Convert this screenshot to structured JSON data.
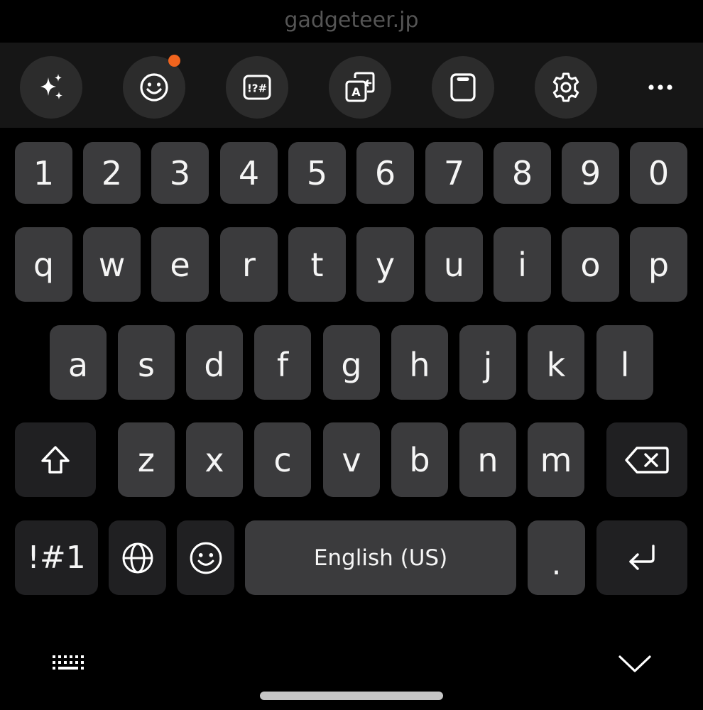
{
  "watermark": "gadgeteer.jp",
  "toolbar": {
    "items": [
      {
        "icon": "sparkle-icon"
      },
      {
        "icon": "emoji-icon",
        "has_notification": true
      },
      {
        "icon": "symbols-icon",
        "label": "!?#"
      },
      {
        "icon": "translate-icon",
        "label": "A"
      },
      {
        "icon": "clipboard-icon"
      },
      {
        "icon": "settings-gear-icon"
      },
      {
        "icon": "more-options-icon"
      }
    ],
    "notification_color": "#f0641e"
  },
  "keyboard": {
    "number_row": [
      "1",
      "2",
      "3",
      "4",
      "5",
      "6",
      "7",
      "8",
      "9",
      "0"
    ],
    "row1": [
      "q",
      "w",
      "e",
      "r",
      "t",
      "y",
      "u",
      "i",
      "o",
      "p"
    ],
    "row2": [
      "a",
      "s",
      "d",
      "f",
      "g",
      "h",
      "j",
      "k",
      "l"
    ],
    "row3": [
      "z",
      "x",
      "c",
      "v",
      "b",
      "n",
      "m"
    ],
    "shift_icon": "shift-arrow-icon",
    "backspace_icon": "backspace-icon",
    "symbols_label": "!#1",
    "language_icon": "globe-icon",
    "emoji_icon": "emoji-icon",
    "space_label": "English (US)",
    "period_label": ".",
    "enter_icon": "enter-return-icon"
  },
  "navigation": {
    "keyboard_switch_icon": "keyboard-icon",
    "hide_keyboard_icon": "chevron-down-icon"
  },
  "colors": {
    "background": "#000000",
    "toolbar": "#161616",
    "key": "#3b3b3d",
    "function_key": "#202022",
    "text": "#f5f5f5"
  }
}
